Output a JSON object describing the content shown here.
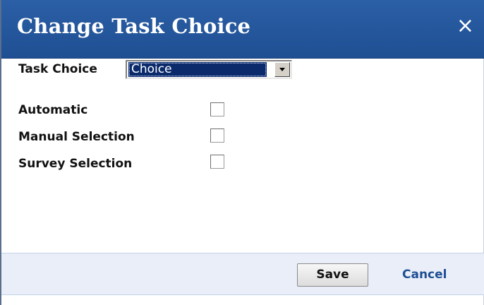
{
  "dialog": {
    "title": "Change Task Choice",
    "close_icon": "×"
  },
  "task_choice": {
    "label": "Task Choice",
    "selected_value": "Choice"
  },
  "options": [
    {
      "label": "Automatic",
      "checked": false
    },
    {
      "label": "Manual Selection",
      "checked": false
    },
    {
      "label": "Survey Selection",
      "checked": false
    }
  ],
  "footer": {
    "save_label": "Save",
    "cancel_label": "Cancel"
  },
  "colors": {
    "titlebar": "#1f4f93",
    "footer_bg": "#e9eef8",
    "link": "#1f4f93",
    "selection": "#0a2a6b"
  }
}
